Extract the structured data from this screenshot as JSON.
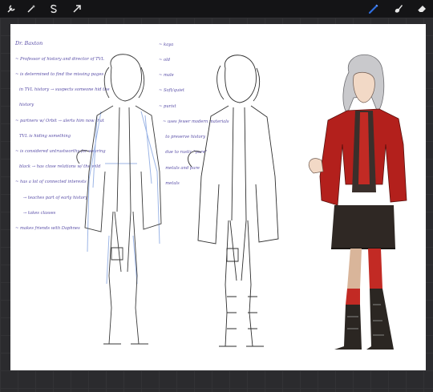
{
  "toolbar": {
    "left_tools": [
      "wrench-icon",
      "magic-wand-icon",
      "selection-s-icon",
      "transform-arrow-icon"
    ],
    "right_tools": [
      "brush-icon",
      "smudge-icon",
      "eraser-icon"
    ],
    "active_tool": "brush",
    "active_color": "#2f6fe0"
  },
  "notes_left": {
    "title": "Dr. Baxton",
    "lines": [
      "~ Professor of history and director of TVL",
      "~ is determined to find the missing pages",
      "   in TVL history → suspects someone hid the",
      "   history",
      "~ partners w/ Orbit → alerts him now that",
      "   TVL is hiding something",
      "~ is considered untrustworthy for wearing",
      "   black → has close relations w/ the wild",
      "~ has a lot of connected interests",
      "      → teaches part of early history",
      "      → takes classes",
      "~ makes friends with Daphnes"
    ]
  },
  "notes_right": {
    "lines": [
      "~ kaya",
      "~ old",
      "~ male",
      "~ Soft/quiet",
      "~ purist",
      "   ~ uses fewer modern materials",
      "     to preserve history",
      "     due to rustic \"pure\"",
      "     metals and pure",
      "     metals"
    ]
  },
  "colors": {
    "coat_red": "#b3201c",
    "hair_gray": "#c9c9cc",
    "boots_dark": "#2b2622",
    "sketch_blue": "#9cb5e6",
    "ink": "#3a3a3a"
  }
}
